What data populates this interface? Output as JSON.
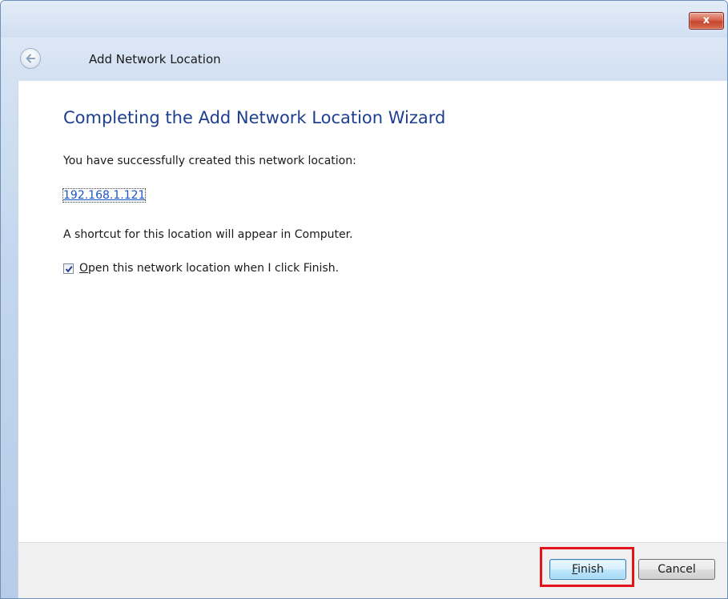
{
  "window": {
    "close_glyph": "x",
    "title": "Add Network Location"
  },
  "content": {
    "heading": "Completing the Add Network Location Wizard",
    "success_text": "You have successfully created this network location:",
    "location_link": "192.168.1.121",
    "shortcut_text": "A shortcut for this location will appear in Computer.",
    "open_checkbox": {
      "checked": true,
      "mnemonic": "O",
      "label_rest": "pen this network location when I click Finish."
    }
  },
  "footer": {
    "finish_button": {
      "mnemonic": "F",
      "label_rest": "inish"
    },
    "cancel_button": "Cancel"
  },
  "colors": {
    "heading": "#1e3f8f",
    "link": "#1a56c6",
    "highlight": "#e2141b"
  },
  "icons": [
    "back-arrow-icon",
    "close-icon",
    "checkmark-icon"
  ]
}
